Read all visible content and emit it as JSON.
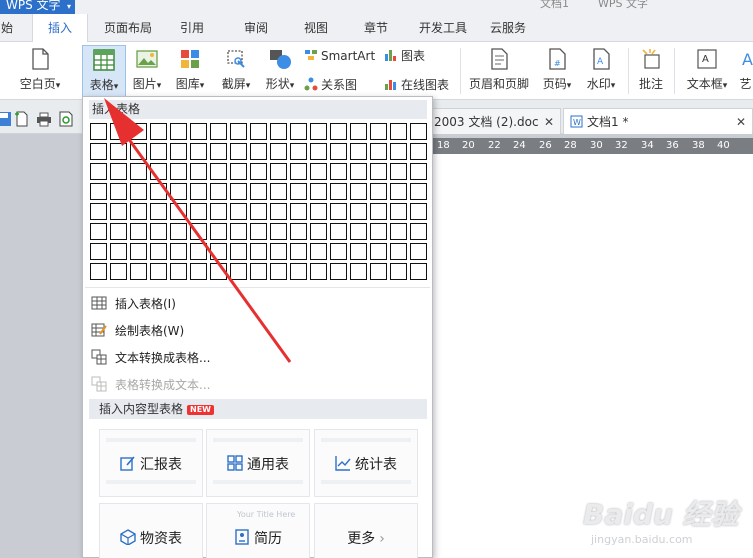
{
  "title_bar": {
    "app_button": "WPS 文字",
    "doc_tabs": [
      "文档1",
      "WPS 文字"
    ]
  },
  "menu_tabs": [
    {
      "label": "始"
    },
    {
      "label": "插入",
      "active": true
    },
    {
      "label": "页面布局"
    },
    {
      "label": "引用"
    },
    {
      "label": "审阅"
    },
    {
      "label": "视图"
    },
    {
      "label": "章节"
    },
    {
      "label": "开发工具"
    },
    {
      "label": "云服务"
    }
  ],
  "ribbon": {
    "blank_page": "空白页",
    "table": "表格",
    "picture": "图片",
    "gallery": "图库",
    "screenshot": "截屏",
    "shapes": "形状",
    "smartart": "SmartArt",
    "chart": "图表",
    "relation_chart": "关系图",
    "online_chart": "在线图表",
    "header_footer": "页眉和页脚",
    "page_number": "页码",
    "watermark": "水印",
    "comment": "批注",
    "textbox": "文本框",
    "art": "艺"
  },
  "doc_tabs": [
    {
      "label": "2003 文档 (2).doc"
    },
    {
      "label": "文档1 *"
    }
  ],
  "ruler": {
    "ticks": [
      "18",
      "20",
      "22",
      "24",
      "26",
      "28",
      "30",
      "32",
      "34",
      "36",
      "38",
      "40"
    ]
  },
  "dropdown": {
    "header": "插入表格",
    "grid": {
      "rows": 8,
      "cols": 17
    },
    "items": [
      {
        "label": "插入表格(I)",
        "enabled": true
      },
      {
        "label": "绘制表格(W)",
        "enabled": true
      },
      {
        "label": "文本转换成表格...",
        "enabled": true
      },
      {
        "label": "表格转换成文本...",
        "enabled": false
      }
    ],
    "content_section": {
      "label": "插入内容型表格",
      "badge": "NEW"
    },
    "cards": [
      {
        "label": "汇报表",
        "icon": "edit-icon"
      },
      {
        "label": "通用表",
        "icon": "grid-icon"
      },
      {
        "label": "统计表",
        "icon": "line-chart-icon"
      },
      {
        "label": "物资表",
        "icon": "box-icon"
      },
      {
        "label": "简历",
        "icon": "id-card-icon",
        "ghost_text": "Your Title Here"
      },
      {
        "label": "更多",
        "icon": "chevron-right-icon"
      }
    ]
  },
  "watermark": {
    "brand": "Baidu 经验",
    "url": "jingyan.baidu.com"
  },
  "colors": {
    "accent": "#2c70c9",
    "arrow": "#e63030",
    "ribbon_selected": "#d7e6f7"
  }
}
